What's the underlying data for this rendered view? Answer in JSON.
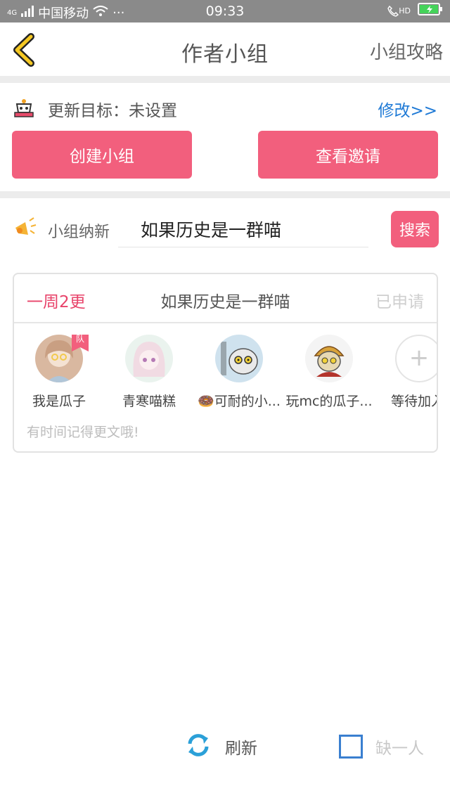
{
  "status_bar": {
    "network": "4G",
    "carrier": "中国移动",
    "more": "···",
    "time": "09:33",
    "hd": "HD"
  },
  "header": {
    "title": "作者小组",
    "guide_link": "小组攻略"
  },
  "target": {
    "label": "更新目标：未设置",
    "edit_link": "修改>>"
  },
  "actions": {
    "create_group": "创建小组",
    "view_invites": "查看邀请"
  },
  "recruit": {
    "label": "小组纳新",
    "input_value": "如果历史是一群喵",
    "search_button": "搜索"
  },
  "group_card": {
    "frequency": "一周2更",
    "name": "如果历史是一群喵",
    "status": "已申请",
    "members": [
      {
        "name": "我是瓜子",
        "badge": "队",
        "avatar_color": "#d9b8a0"
      },
      {
        "name": "青寒喵糕",
        "avatar_color": "#f1dbe3"
      },
      {
        "name": "🍩可耐的小...",
        "avatar_color": "#cfe2ee"
      },
      {
        "name": "玩mc的瓜子...",
        "avatar_color": "#e7d9b3"
      },
      {
        "name": "等待加入"
      }
    ],
    "note": "有时间记得更文哦!"
  },
  "bottom": {
    "refresh": "刷新",
    "short_one": "缺一人"
  },
  "colors": {
    "accent_pink": "#f25f7d",
    "link_blue": "#1f7ad6",
    "status_bar": "#8a8a8a"
  }
}
